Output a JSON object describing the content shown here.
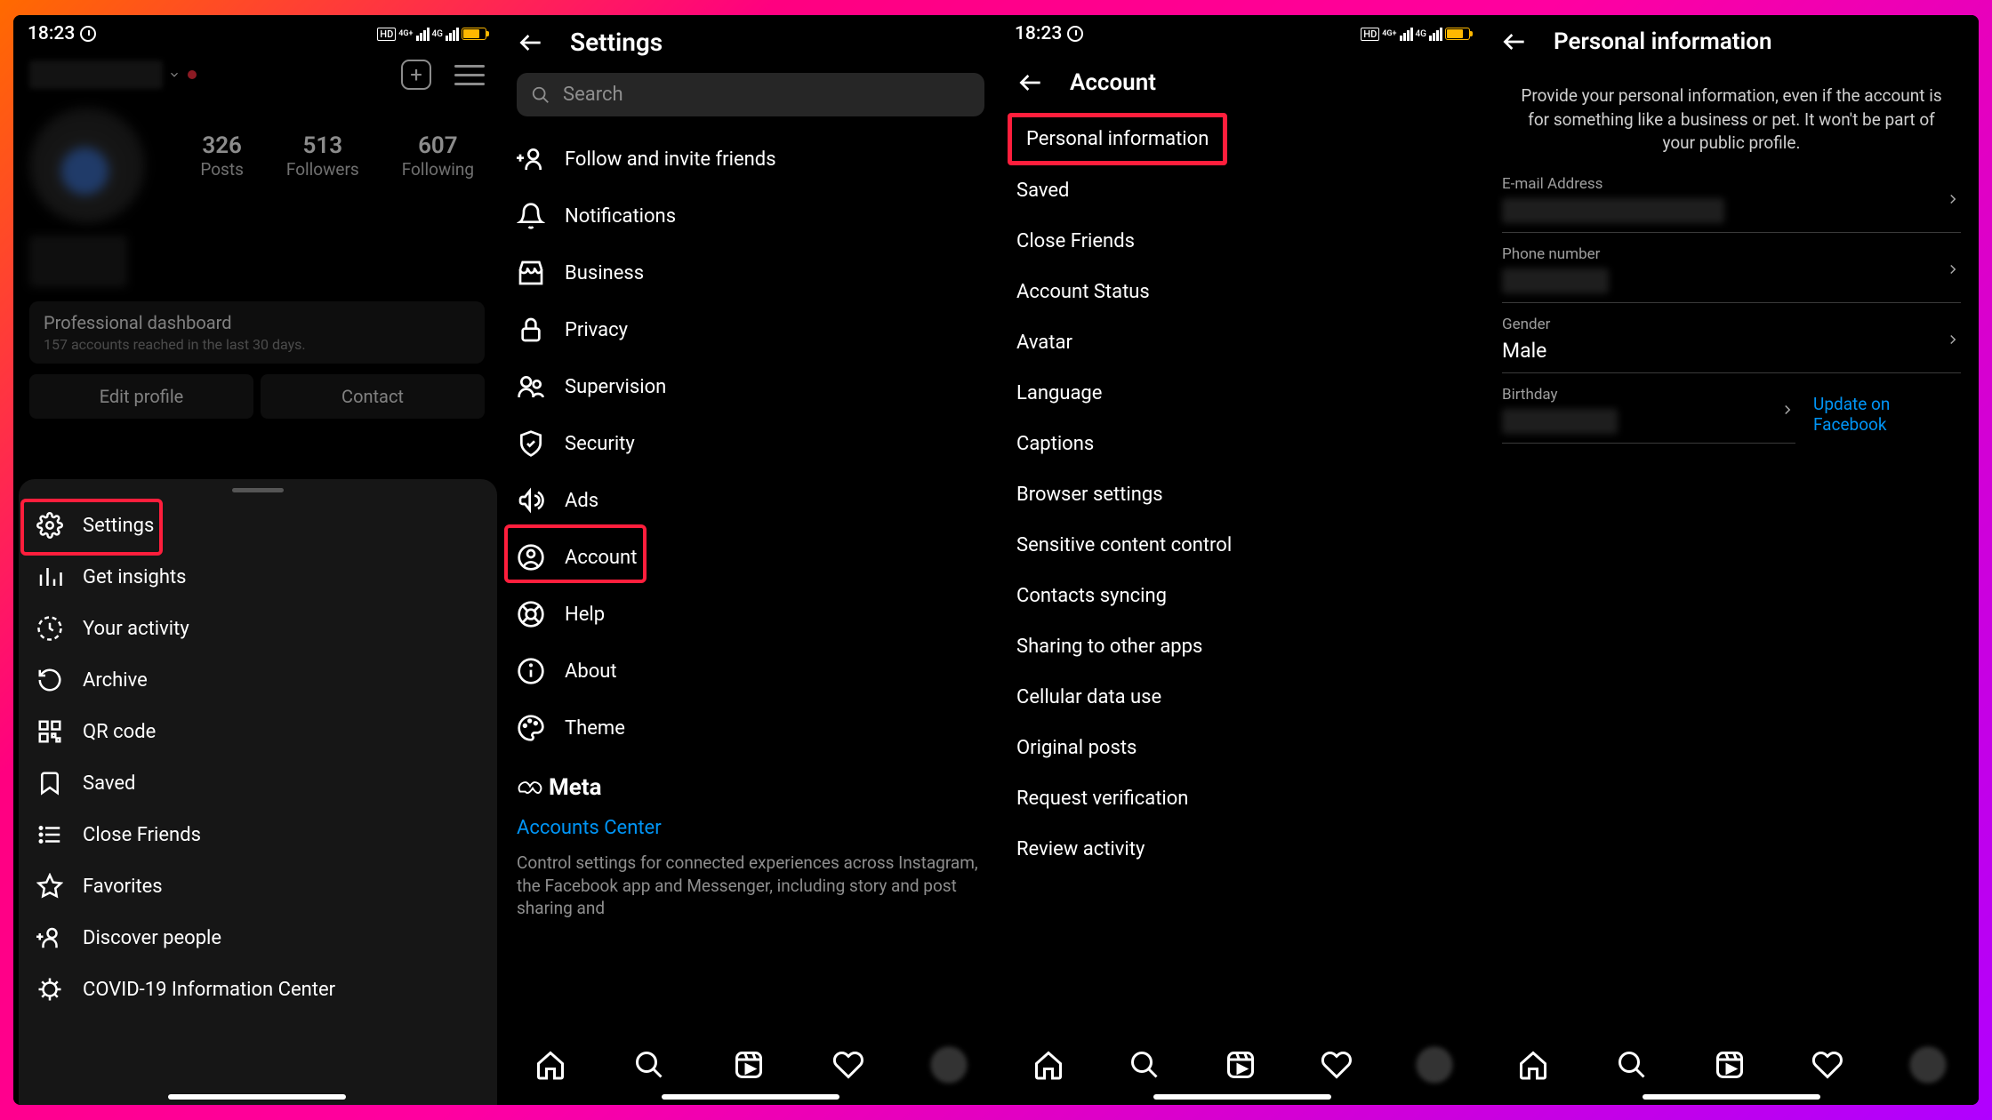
{
  "panel1": {
    "time": "18:23",
    "cell": "4G+",
    "stats": {
      "posts_n": "326",
      "posts_l": "Posts",
      "followers_n": "513",
      "followers_l": "Followers",
      "following_n": "607",
      "following_l": "Following"
    },
    "pro_dash_title": "Professional dashboard",
    "pro_dash_sub": "157 accounts reached in the last 30 days.",
    "edit_profile": "Edit profile",
    "contact": "Contact",
    "sheet": [
      "Settings",
      "Get insights",
      "Your activity",
      "Archive",
      "QR code",
      "Saved",
      "Close Friends",
      "Favorites",
      "Discover people",
      "COVID-19 Information Center"
    ]
  },
  "panel2": {
    "title": "Settings",
    "search_ph": "Search",
    "items": [
      "Follow and invite friends",
      "Notifications",
      "Business",
      "Privacy",
      "Supervision",
      "Security",
      "Ads",
      "Account",
      "Help",
      "About",
      "Theme"
    ],
    "meta_brand": "Meta",
    "accounts_center": "Accounts Center",
    "ac_desc": "Control settings for connected experiences across Instagram, the Facebook app and Messenger, including story and post sharing and"
  },
  "panel3": {
    "time": "18:23",
    "title": "Account",
    "items": [
      "Personal information",
      "Saved",
      "Close Friends",
      "Account Status",
      "Avatar",
      "Language",
      "Captions",
      "Browser settings",
      "Sensitive content control",
      "Contacts syncing",
      "Sharing to other apps",
      "Cellular data use",
      "Original posts",
      "Request verification",
      "Review activity"
    ]
  },
  "panel4": {
    "title": "Personal information",
    "desc": "Provide your personal information, even if the account is for something like a business or pet. It won't be part of your public profile.",
    "email_label": "E-mail Address",
    "phone_label": "Phone number",
    "gender_label": "Gender",
    "gender_value": "Male",
    "birthday_label": "Birthday",
    "update_fb": "Update on Facebook"
  }
}
